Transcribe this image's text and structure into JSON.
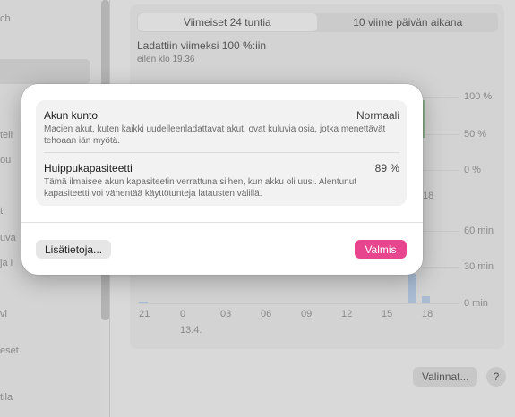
{
  "sidebar": {
    "fragments": [
      "ch",
      "tell",
      "ou",
      "t",
      "uva",
      "ja l",
      "vi",
      "eset",
      "tila"
    ]
  },
  "segmented": {
    "tab_24h": "Viimeiset 24 tuntia",
    "tab_10d": "10 viime päivän aikana"
  },
  "charged": {
    "title": "Ladattiin viimeksi 100 %:iin",
    "subtitle": "eilen klo 19.36"
  },
  "level_chart": {
    "y_ticks": [
      "100 %",
      "50 %",
      "0 %"
    ]
  },
  "usage_chart": {
    "y_ticks": [
      "60 min",
      "30 min",
      "0 min"
    ],
    "x_ticks": [
      "21",
      "0",
      "03",
      "06",
      "09",
      "12",
      "15",
      "18"
    ],
    "date_label": "13.4.",
    "partial_x_tick": "18"
  },
  "footer": {
    "options_label": "Valinnat...",
    "help_label": "?"
  },
  "modal": {
    "health": {
      "title": "Akun kunto",
      "value": "Normaali",
      "description": "Macien akut, kuten kaikki uudelleenladattavat akut, ovat kuluvia osia, jotka menettävät tehoaan iän myötä."
    },
    "capacity": {
      "title": "Huippukapasiteetti",
      "value": "89 %",
      "description": "Tämä ilmaisee akun kapasiteetin verrattuna siihen, kun akku oli uusi. Alentunut kapasiteetti voi vähentää käyttötunteja latausten välillä."
    },
    "more_info_label": "Lisätietoja...",
    "done_label": "Valmis"
  },
  "colors": {
    "accent": "#e8458f",
    "bar": "#a9bcd4",
    "charge": "#8fb08f"
  }
}
